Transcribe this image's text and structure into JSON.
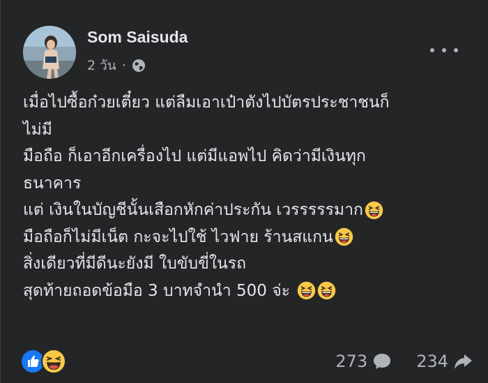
{
  "post": {
    "author": "Som Saisuda",
    "time": "2 วัน",
    "dot": "·",
    "privacy_icon": "globe-icon",
    "more_icon": "more-options-icon",
    "lines": [
      "เมื่อไปซื้อก๋วยเตี๋ยว แต่ลืมเอาเป๋าตังไปบัตรประชาชนก็",
      "ไม่มี",
      "มือถือ ก็เอาอีกเครื่องไป แต่มีแอพไป คิดว่ามีเงินทุก",
      "ธนาคาร",
      "แต่ เงินในบัญชีนั้นเสือกหักค่าประกัน เวรรรรรมาก",
      "มือถือก็ไม่มีเน็ต กะจะไปใช้ ไวฟาย ร้านสแกน",
      "สิ่งเดียวที่มีดีนะยังมี ใบขับขี่ในรถ",
      "สุดท้ายถอดข้อมือ 3 บาทจำนำ 500 จ่ะ"
    ],
    "emoji": "laughing-squinting-face"
  },
  "footer": {
    "reactions": [
      "like",
      "haha"
    ],
    "comment_count": "273",
    "share_count": "234"
  },
  "colors": {
    "background": "#242526",
    "text": "#e4e6eb",
    "secondary": "#b0b3b8",
    "like_blue": "#1877f2",
    "emoji_yellow": "#f7c948"
  }
}
